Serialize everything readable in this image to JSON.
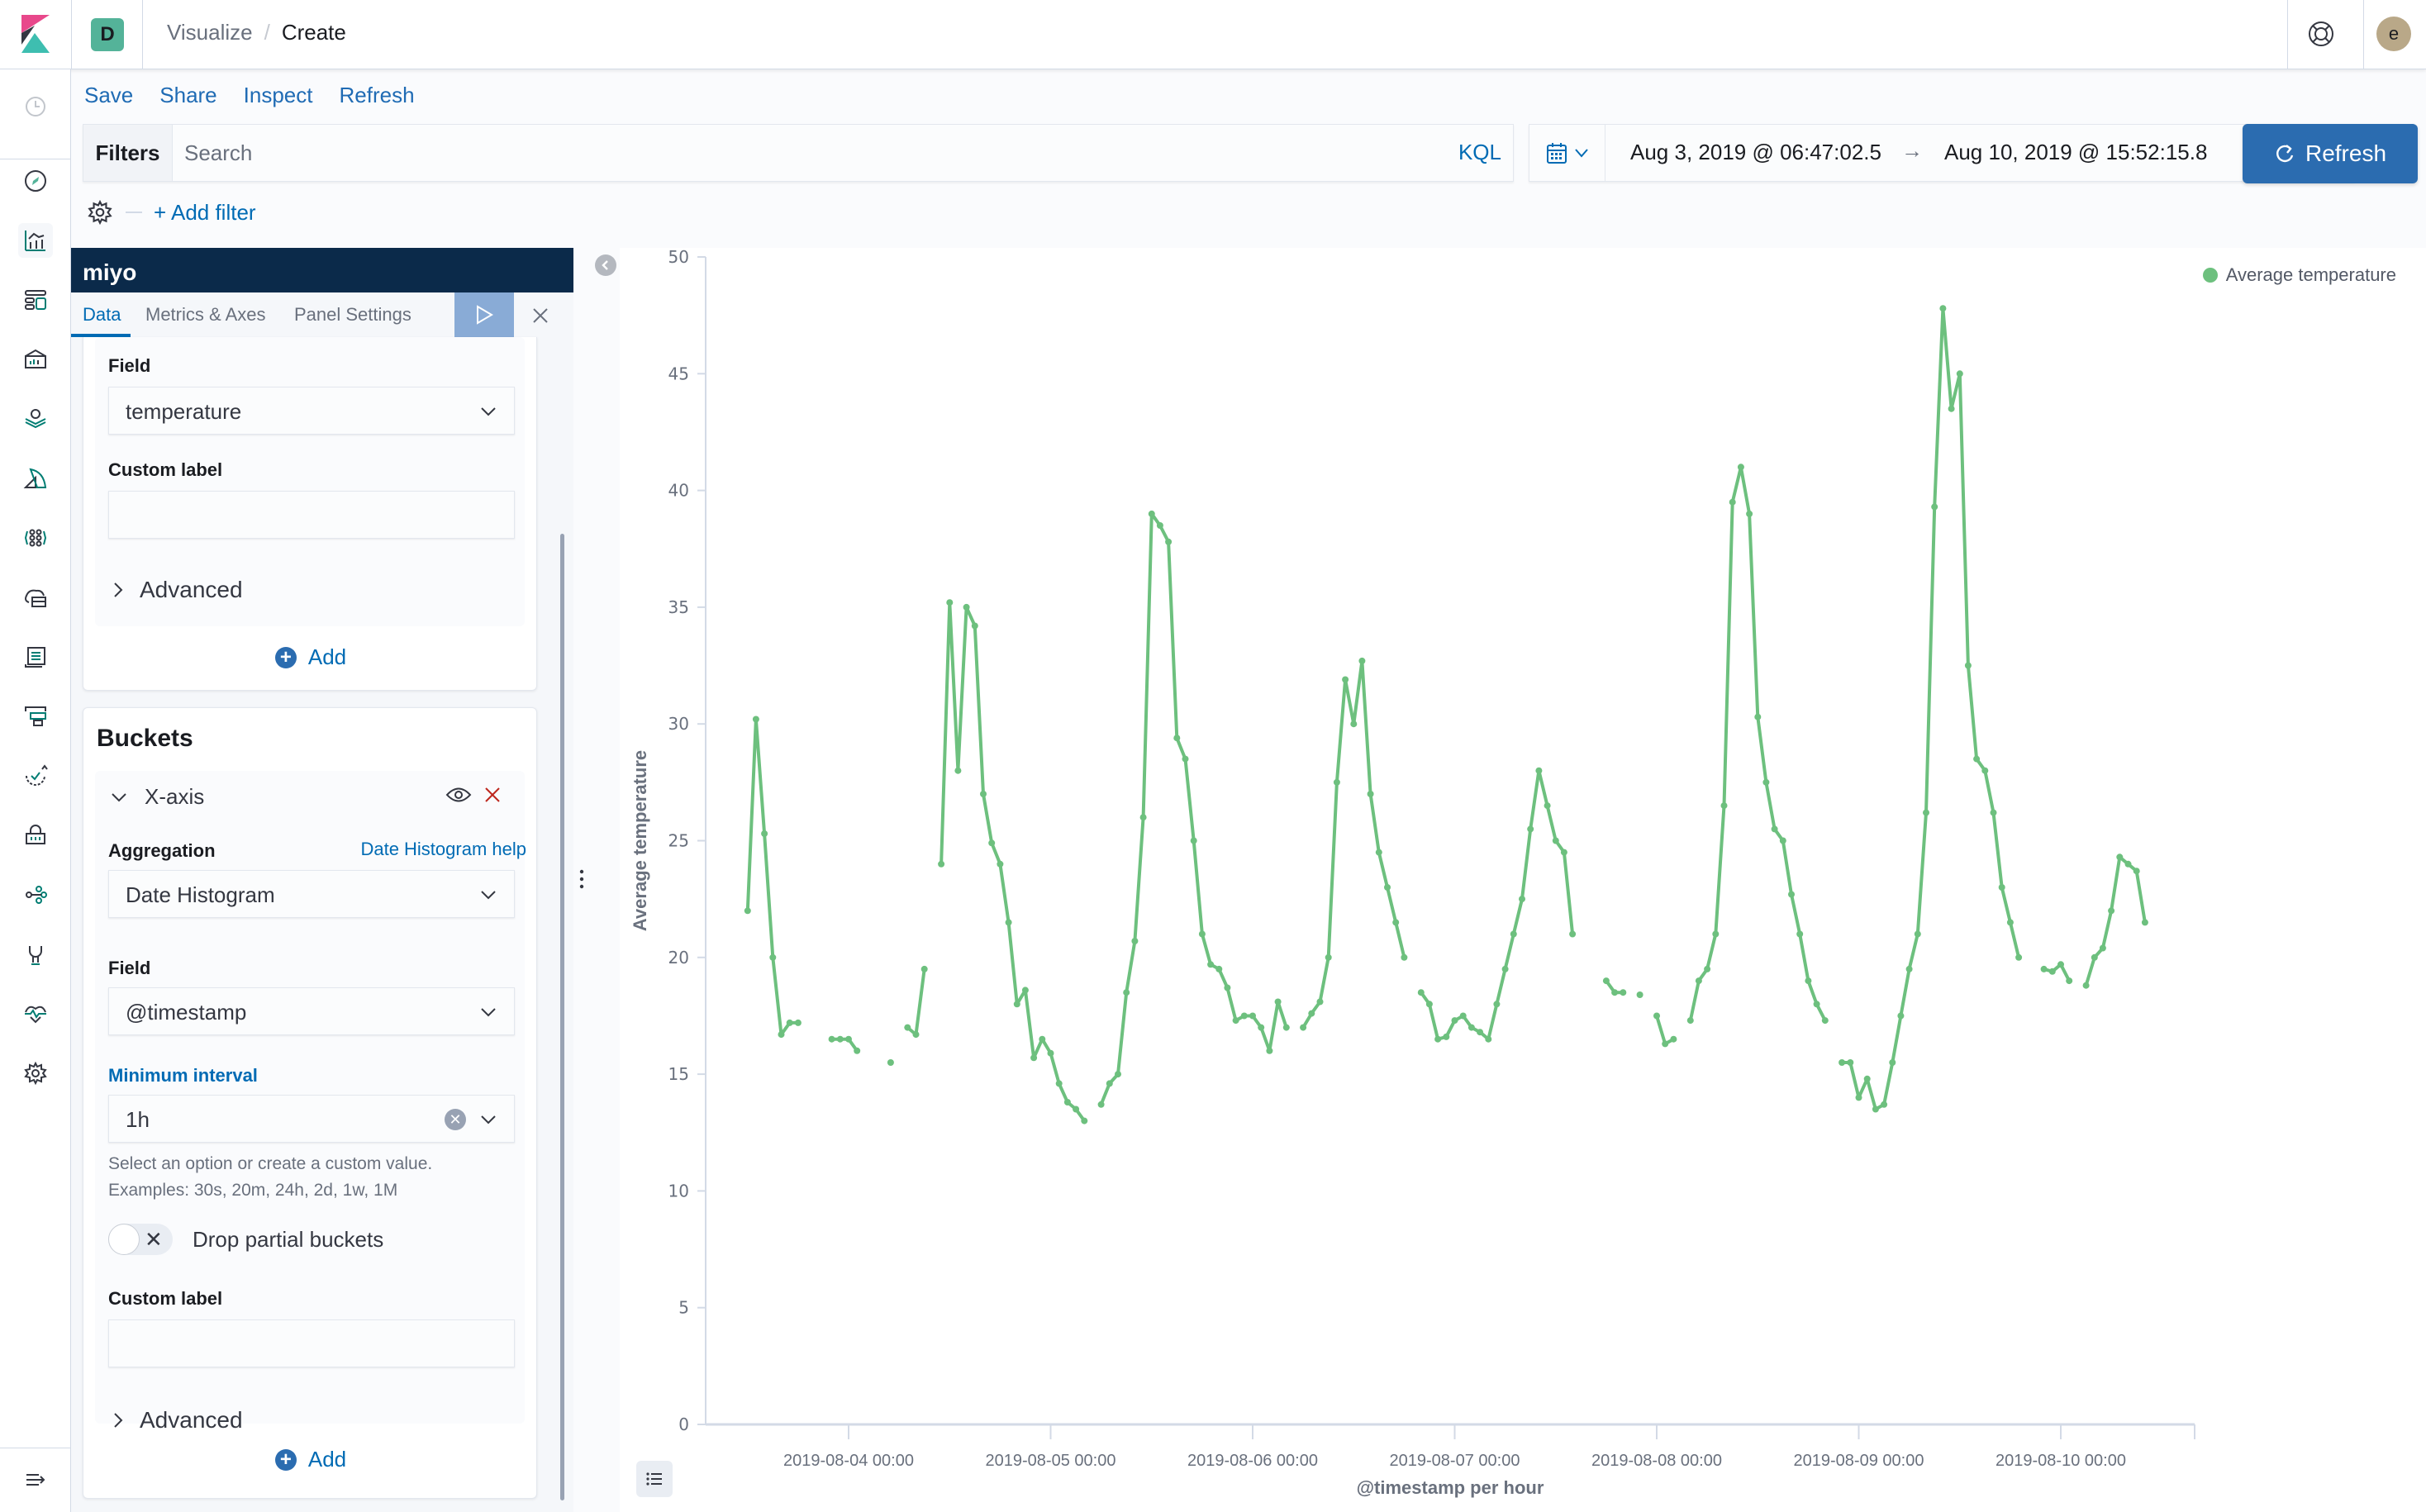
{
  "header": {
    "space_initial": "D",
    "breadcrumbs": [
      "Visualize",
      "Create"
    ],
    "avatar_initial": "e"
  },
  "nav": {
    "icons": [
      "recently-viewed-icon",
      "discover-icon",
      "visualize-icon",
      "dashboard-icon",
      "canvas-icon",
      "maps-icon",
      "machine-learning-icon",
      "graph-icon",
      "infrastructure-icon",
      "logs-icon",
      "apm-icon",
      "uptime-icon",
      "siem-icon",
      "graph-network-icon",
      "dev-tools-icon",
      "monitoring-icon",
      "management-icon",
      "collapse-nav-icon"
    ]
  },
  "menu": {
    "items": [
      "Save",
      "Share",
      "Inspect",
      "Refresh"
    ]
  },
  "query": {
    "filters_label": "Filters",
    "search_placeholder": "Search",
    "language": "KQL",
    "add_filter": "+ Add filter"
  },
  "time": {
    "start": "Aug 3, 2019 @ 06:47:02.5",
    "arrow": "→",
    "end": "Aug 10, 2019 @ 15:52:15.8",
    "refresh_label": "Refresh"
  },
  "editor": {
    "index_title": "miyo",
    "tabs": [
      "Data",
      "Metrics & Axes",
      "Panel Settings"
    ],
    "metric": {
      "field_label": "Field",
      "field_value": "temperature",
      "custom_label": "Custom label",
      "custom_value": "",
      "advanced": "Advanced",
      "add": "Add"
    },
    "buckets": {
      "title": "Buckets",
      "agg_name": "X-axis",
      "aggregation_label": "Aggregation",
      "help_link": "Date Histogram help",
      "aggregation_value": "Date Histogram",
      "field_label": "Field",
      "field_value": "@timestamp",
      "interval_label": "Minimum interval",
      "interval_value": "1h",
      "help_line1": "Select an option or create a custom value.",
      "help_line2": "Examples: 30s, 20m, 24h, 2d, 1w, 1M",
      "drop_partial": "Drop partial buckets",
      "drop_partial_on": false,
      "custom_label": "Custom label",
      "custom_value": "",
      "advanced": "Advanced",
      "add": "Add"
    }
  },
  "colors": {
    "series": "#6dc07e",
    "accent": "#006bb4",
    "primary_button": "#2b6cb0",
    "editor_header": "#0b2a4a",
    "danger": "#bd271e"
  },
  "chart_data": {
    "type": "line",
    "title": "",
    "xlabel": "@timestamp per hour",
    "ylabel": "Average temperature",
    "ylim": [
      0,
      50
    ],
    "yticks": [
      0,
      5,
      10,
      15,
      20,
      25,
      30,
      35,
      40,
      45,
      50
    ],
    "xtick_labels": [
      "2019-08-04 00:00",
      "2019-08-05 00:00",
      "2019-08-06 00:00",
      "2019-08-07 00:00",
      "2019-08-08 00:00",
      "2019-08-09 00:00",
      "2019-08-10 00:00"
    ],
    "x_start": "2019-08-03 06:00",
    "x_interval": "1h",
    "grid": false,
    "legend": {
      "position": "top-right",
      "entries": [
        "Average temperature"
      ]
    },
    "series": [
      {
        "name": "Average temperature",
        "note": "hourly values starting 2019-08-03 12:00; null = no data (line gap)",
        "start": "2019-08-03 12:00",
        "values": [
          22.0,
          30.2,
          25.3,
          20.0,
          16.7,
          17.2,
          17.2,
          null,
          null,
          null,
          16.5,
          16.5,
          16.5,
          16.0,
          null,
          null,
          null,
          15.5,
          null,
          17.0,
          16.7,
          19.5,
          null,
          24.0,
          35.2,
          28.0,
          35.0,
          34.2,
          27.0,
          24.9,
          24.0,
          21.5,
          18.0,
          18.6,
          15.7,
          16.5,
          15.9,
          14.6,
          13.8,
          13.5,
          13.0,
          null,
          13.7,
          14.6,
          15.0,
          18.5,
          20.7,
          26.0,
          39.0,
          38.5,
          37.8,
          29.4,
          28.5,
          25.0,
          21.0,
          19.7,
          19.5,
          18.7,
          17.3,
          17.5,
          17.5,
          17.0,
          16.0,
          18.1,
          17.0,
          null,
          17.0,
          17.6,
          18.1,
          20.0,
          27.5,
          31.9,
          30.0,
          32.7,
          27.0,
          24.5,
          23.0,
          21.5,
          20.0,
          null,
          18.5,
          18.0,
          16.5,
          16.6,
          17.3,
          17.5,
          17.0,
          16.8,
          16.5,
          18.0,
          19.5,
          21.0,
          22.5,
          25.5,
          28.0,
          26.5,
          25.0,
          24.5,
          21.0,
          null,
          null,
          null,
          19.0,
          18.5,
          18.5,
          null,
          18.4,
          null,
          17.5,
          16.3,
          16.5,
          null,
          17.3,
          19.0,
          19.5,
          21.0,
          26.5,
          39.5,
          41.0,
          39.0,
          30.3,
          27.5,
          25.5,
          25.0,
          22.7,
          21.0,
          19.0,
          18.0,
          17.3,
          null,
          15.5,
          15.5,
          14.0,
          14.8,
          13.5,
          13.7,
          15.5,
          17.5,
          19.5,
          21.0,
          26.2,
          39.3,
          47.8,
          43.5,
          45.0,
          32.5,
          28.5,
          28.0,
          26.2,
          23.0,
          21.5,
          20.0,
          null,
          null,
          19.5,
          19.4,
          19.7,
          19.0,
          null,
          18.8,
          20.0,
          20.4,
          22.0,
          24.3,
          24.0,
          23.7,
          21.5
        ]
      }
    ]
  }
}
